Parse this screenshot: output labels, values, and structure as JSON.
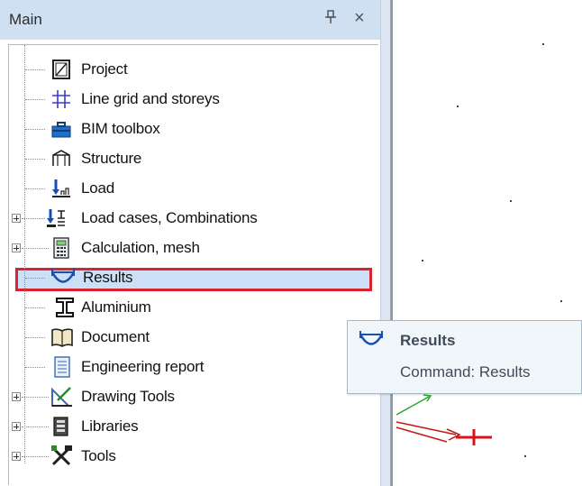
{
  "panel": {
    "title": "Main",
    "pin_glyph": "ᵖ",
    "close_glyph": "×"
  },
  "tree": {
    "items": [
      {
        "label": "Project",
        "icon": "project-icon",
        "expandable": false
      },
      {
        "label": "Line grid and storeys",
        "icon": "line-grid-icon",
        "expandable": false
      },
      {
        "label": "BIM toolbox",
        "icon": "toolbox-icon",
        "expandable": false
      },
      {
        "label": "Structure",
        "icon": "structure-icon",
        "expandable": false
      },
      {
        "label": "Load",
        "icon": "load-icon",
        "expandable": false
      },
      {
        "label": "Load cases, Combinations",
        "icon": "load-cases-icon",
        "expandable": true
      },
      {
        "label": "Calculation, mesh",
        "icon": "calculator-icon",
        "expandable": true
      },
      {
        "label": "Results",
        "icon": "results-icon",
        "expandable": false,
        "selected": true
      },
      {
        "label": "Aluminium",
        "icon": "aluminium-icon",
        "expandable": false
      },
      {
        "label": "Document",
        "icon": "document-icon",
        "expandable": false
      },
      {
        "label": "Engineering report",
        "icon": "report-icon",
        "expandable": false
      },
      {
        "label": "Drawing Tools",
        "icon": "drawing-tools-icon",
        "expandable": true
      },
      {
        "label": "Libraries",
        "icon": "libraries-icon",
        "expandable": true
      },
      {
        "label": "Tools",
        "icon": "tools-icon",
        "expandable": true
      }
    ]
  },
  "tooltip": {
    "title": "Results",
    "command": "Command: Results"
  },
  "colors": {
    "header_bg": "#cfe0f3",
    "selection_bg": "#cbe0f7",
    "highlight_border": "#d9232e"
  }
}
